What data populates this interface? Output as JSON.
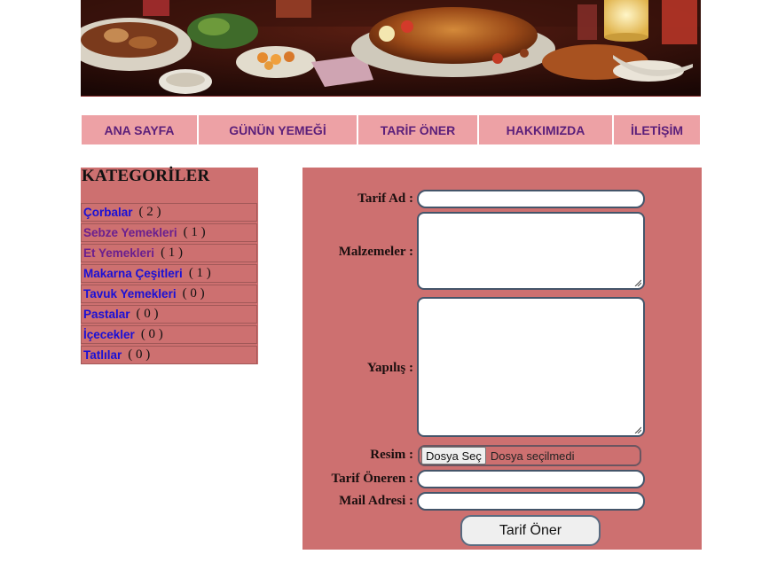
{
  "header": {
    "banner_image": "holiday-feast-table-photo"
  },
  "nav": {
    "items": [
      {
        "label": "ANA SAYFA"
      },
      {
        "label": "GÜNÜN YEMEĞİ"
      },
      {
        "label": "TARİF ÖNER"
      },
      {
        "label": "HAKKIMIZDA"
      },
      {
        "label": "İLETİŞİM"
      }
    ]
  },
  "sidebar": {
    "title": "KATEGORİLER",
    "categories": [
      {
        "name": "Çorbalar",
        "count": "( 2 )"
      },
      {
        "name": "Sebze Yemekleri",
        "count": "( 1 )"
      },
      {
        "name": "Et Yemekleri",
        "count": "( 1 )"
      },
      {
        "name": "Makarna Çeşitleri",
        "count": "( 1 )"
      },
      {
        "name": "Tavuk Yemekleri",
        "count": "( 0 )"
      },
      {
        "name": "Pastalar",
        "count": "( 0 )"
      },
      {
        "name": "İçecekler",
        "count": "( 0 )"
      },
      {
        "name": "Tatlılar",
        "count": "( 0 )"
      }
    ]
  },
  "form": {
    "recipe_name_label": "Tarif Ad :",
    "recipe_name_value": "",
    "ingredients_label": "Malzemeler :",
    "ingredients_value": "",
    "preparation_label": "Yapılış :",
    "preparation_value": "",
    "image_label": "Resim :",
    "file_button_label": "Dosya Seç",
    "file_status": "Dosya seçilmedi",
    "author_label": "Tarif Öneren :",
    "author_value": "",
    "email_label": "Mail Adresi :",
    "email_value": "",
    "submit_label": "Tarif Öner"
  },
  "colors": {
    "nav_bg": "#eda1a5",
    "nav_text": "#5b1f7a",
    "panel_bg": "#cd7070",
    "link": "#1a10d6",
    "link_visited": "#6a1f8f"
  }
}
